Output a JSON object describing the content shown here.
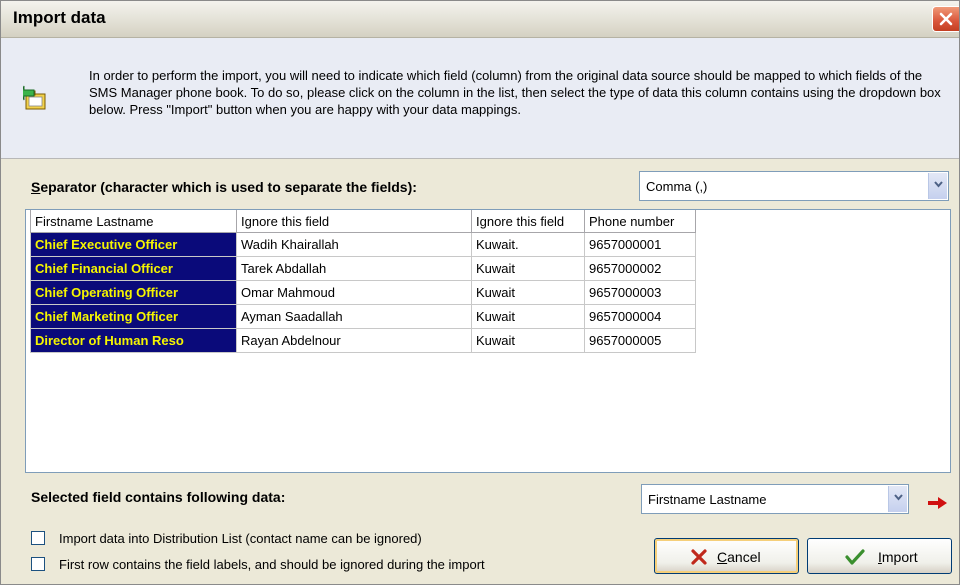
{
  "window": {
    "title": "Import data"
  },
  "info": {
    "text": "In order to perform the import, you will need to indicate which field (column) from the original data source should be mapped to which fields of the SMS Manager phone book. To do so, please click on the column in the list, then select the type of data this column contains using the dropdown box below. Press \"Import\" button when you are happy with your data mappings."
  },
  "separator": {
    "label_first": "S",
    "label_rest": "eparator (character which is used to separate the fields):",
    "value": "Comma (,)"
  },
  "grid": {
    "headers": [
      "Firstname Lastname",
      "Ignore this field",
      "Ignore this field",
      "Phone number"
    ],
    "rows": [
      [
        "Chief Executive Officer",
        "Wadih Khairallah",
        "Kuwait.",
        "9657000001"
      ],
      [
        "Chief Financial Officer",
        "Tarek Abdallah",
        "Kuwait",
        "9657000002"
      ],
      [
        "Chief Operating Officer",
        "Omar Mahmoud",
        "Kuwait",
        "9657000003"
      ],
      [
        "Chief Marketing Officer",
        "Ayman Saadallah",
        "Kuwait",
        "9657000004"
      ],
      [
        "Director of Human Reso",
        "Rayan Abdelnour",
        "Kuwait",
        "9657000005"
      ]
    ]
  },
  "selected_field": {
    "label": "Selected field contains following data:",
    "value": "Firstname Lastname"
  },
  "options": {
    "distribution_list": "Import data into Distribution List (contact name can be ignored)",
    "first_row_labels": "First row contains the field labels, and should be ignored during the import"
  },
  "buttons": {
    "cancel_first": "C",
    "cancel_rest": "ancel",
    "import_first": "I",
    "import_rest": "mport"
  },
  "colors": {
    "selected_column_bg": "#0a0a7a",
    "selected_column_text": "#f5f500",
    "close_button": "#d9553a"
  }
}
